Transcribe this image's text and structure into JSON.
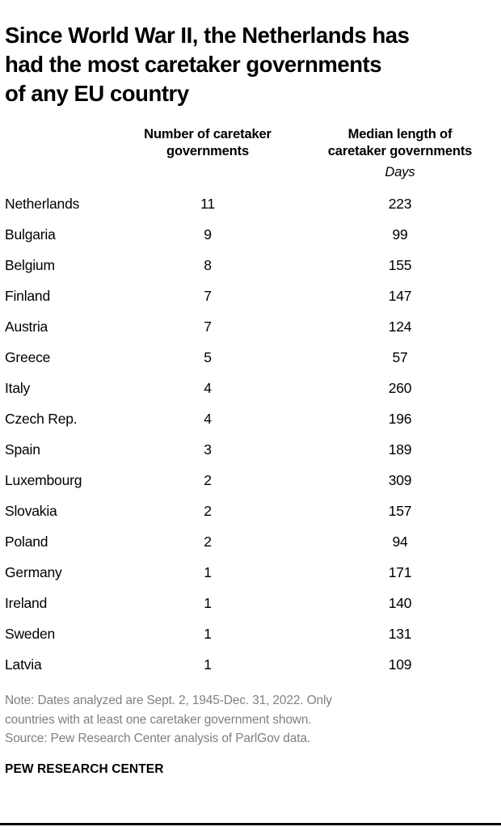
{
  "title": "Since World War II, the Netherlands has\nhad the most caretaker governments\nof any EU country",
  "table": {
    "headers": {
      "country": "",
      "count": "Number of caretaker\ngovernments",
      "median": "Median length of\ncaretaker governments"
    },
    "units": {
      "count": "",
      "median": "Days"
    },
    "rows": [
      {
        "country": "Netherlands",
        "count": "11",
        "median": "223"
      },
      {
        "country": "Bulgaria",
        "count": "9",
        "median": "99"
      },
      {
        "country": "Belgium",
        "count": "8",
        "median": "155"
      },
      {
        "country": "Finland",
        "count": "7",
        "median": "147"
      },
      {
        "country": "Austria",
        "count": "7",
        "median": "124"
      },
      {
        "country": "Greece",
        "count": "5",
        "median": "57"
      },
      {
        "country": "Italy",
        "count": "4",
        "median": "260"
      },
      {
        "country": "Czech Rep.",
        "count": "4",
        "median": "196"
      },
      {
        "country": "Spain",
        "count": "3",
        "median": "189"
      },
      {
        "country": "Luxembourg",
        "count": "2",
        "median": "309"
      },
      {
        "country": "Slovakia",
        "count": "2",
        "median": "157"
      },
      {
        "country": "Poland",
        "count": "2",
        "median": "94"
      },
      {
        "country": "Germany",
        "count": "1",
        "median": "171"
      },
      {
        "country": "Ireland",
        "count": "1",
        "median": "140"
      },
      {
        "country": "Sweden",
        "count": "1",
        "median": "131"
      },
      {
        "country": "Latvia",
        "count": "1",
        "median": "109"
      }
    ]
  },
  "footer": {
    "note": "Note: Dates analyzed are Sept. 2, 1945-Dec. 31, 2022. Only\ncountries with at least one caretaker government shown.",
    "source": "Source: Pew Research Center analysis of ParlGov data.",
    "brand": "PEW RESEARCH CENTER"
  },
  "chart_data": {
    "type": "table",
    "title": "Since World War II, the Netherlands has had the most caretaker governments of any EU country",
    "categories": [
      "Netherlands",
      "Bulgaria",
      "Belgium",
      "Finland",
      "Austria",
      "Greece",
      "Italy",
      "Czech Rep.",
      "Spain",
      "Luxembourg",
      "Slovakia",
      "Poland",
      "Germany",
      "Ireland",
      "Sweden",
      "Latvia"
    ],
    "series": [
      {
        "name": "Number of caretaker governments",
        "units": "",
        "values": [
          11,
          9,
          8,
          7,
          7,
          5,
          4,
          4,
          3,
          2,
          2,
          2,
          1,
          1,
          1,
          1
        ]
      },
      {
        "name": "Median length of caretaker governments",
        "units": "Days",
        "values": [
          223,
          99,
          155,
          147,
          124,
          57,
          260,
          196,
          189,
          309,
          157,
          94,
          171,
          140,
          131,
          109
        ]
      }
    ],
    "xlabel": "",
    "ylabel": "",
    "grid": false,
    "legend": "none",
    "note": "Note: Dates analyzed are Sept. 2, 1945-Dec. 31, 2022. Only countries with at least one caretaker government shown.",
    "source": "Source: Pew Research Center analysis of ParlGov data."
  }
}
